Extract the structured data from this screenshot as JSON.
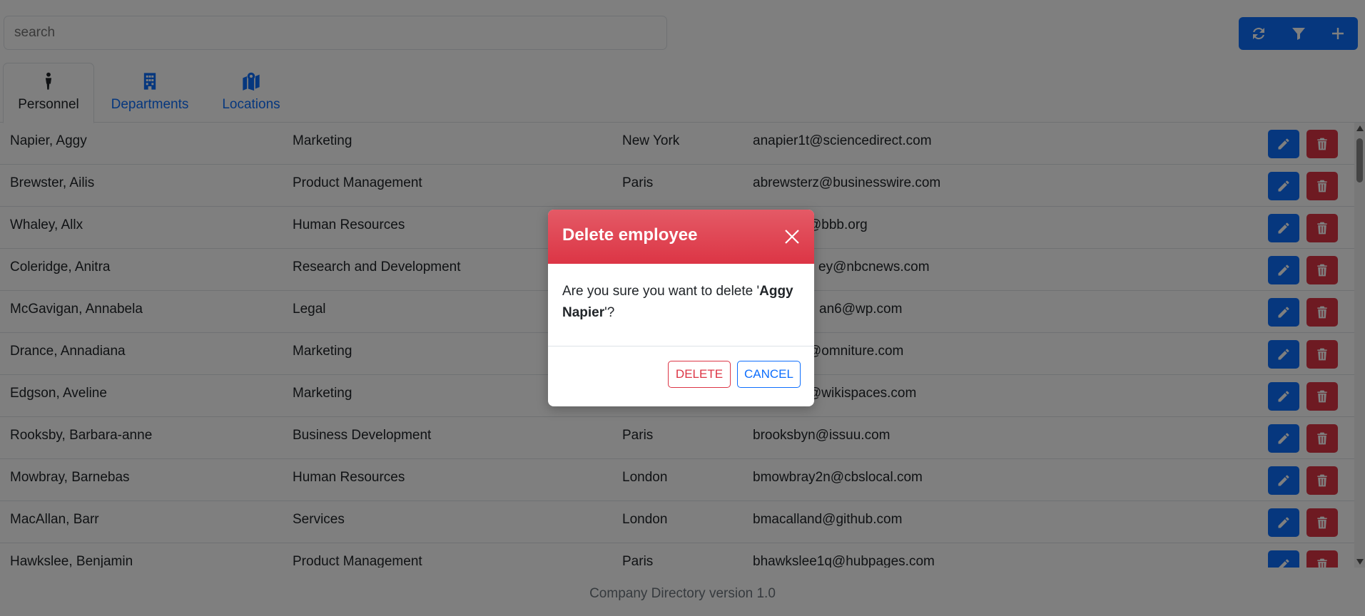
{
  "search": {
    "placeholder": "search"
  },
  "toolbar": {
    "buttons": [
      {
        "name": "refresh-icon"
      },
      {
        "name": "filter-icon"
      },
      {
        "name": "plus-icon"
      }
    ]
  },
  "tabs": [
    {
      "label": "Personnel",
      "icon": "person-icon",
      "active": true
    },
    {
      "label": "Departments",
      "icon": "building-icon",
      "active": false
    },
    {
      "label": "Locations",
      "icon": "map-location-icon",
      "active": false
    }
  ],
  "table": {
    "rows": [
      {
        "name": "Napier, Aggy",
        "department": "Marketing",
        "location": "New York",
        "email": "anapier1t@sciencedirect.com"
      },
      {
        "name": "Brewster, Ailis",
        "department": "Product Management",
        "location": "Paris",
        "email": "abrewsterz@businesswire.com"
      },
      {
        "name": "Whaley, Allx",
        "department": "Human Resources",
        "location": "",
        "email": "@bbb.org"
      },
      {
        "name": "Coleridge, Anitra",
        "department": "Research and Development",
        "location": "",
        "email": "ey@nbcnews.com"
      },
      {
        "name": "McGavigan, Annabela",
        "department": "Legal",
        "location": "",
        "email": "an6@wp.com"
      },
      {
        "name": "Drance, Annadiana",
        "department": "Marketing",
        "location": "",
        "email": "@omniture.com"
      },
      {
        "name": "Edgson, Aveline",
        "department": "Marketing",
        "location": "",
        "email": "@wikispaces.com"
      },
      {
        "name": "Rooksby, Barbara-anne",
        "department": "Business Development",
        "location": "Paris",
        "email": "brooksbyn@issuu.com"
      },
      {
        "name": "Mowbray, Barnebas",
        "department": "Human Resources",
        "location": "London",
        "email": "bmowbray2n@cbslocal.com"
      },
      {
        "name": "MacAllan, Barr",
        "department": "Services",
        "location": "London",
        "email": "bmacalland@github.com"
      },
      {
        "name": "Hawkslee, Benjamin",
        "department": "Product Management",
        "location": "Paris",
        "email": "bhawkslee1q@hubpages.com"
      }
    ]
  },
  "footer": {
    "text": "Company Directory version 1.0"
  },
  "modal": {
    "title": "Delete employee",
    "body_prefix": "Are you sure you want to delete '",
    "employee_name": "Aggy Napier",
    "body_suffix": "'?",
    "delete_label": "DELETE",
    "cancel_label": "CANCEL"
  },
  "colors": {
    "primary": "#0d6efd",
    "danger": "#dc3545"
  }
}
